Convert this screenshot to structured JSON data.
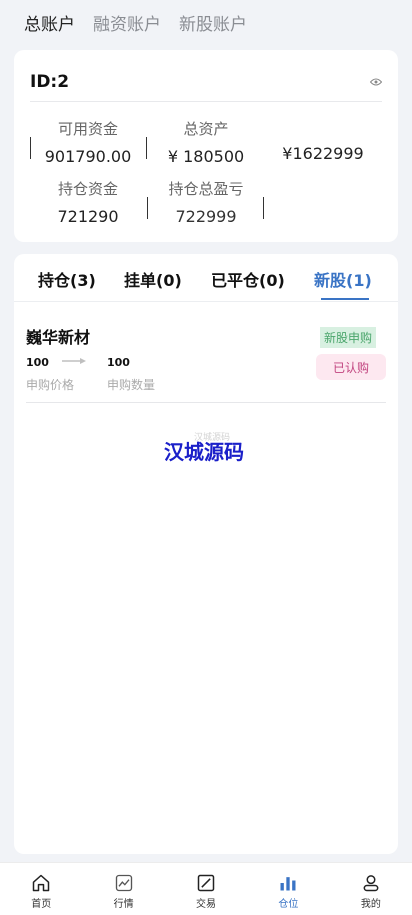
{
  "top_tabs": [
    {
      "label": "总账户"
    },
    {
      "label": "融资账户"
    },
    {
      "label": "新股账户"
    }
  ],
  "account": {
    "id_label": "ID:2",
    "available_funds_label": "可用资金",
    "available_funds_value": "901790.00",
    "total_assets_label": "总资产",
    "total_assets_value": "¥ 180500",
    "third_value": "¥1622999",
    "position_funds_label": "持仓资金",
    "position_funds_value": "721290",
    "position_pnl_label": "持仓总盈亏",
    "position_pnl_value": "722999"
  },
  "position_tabs": [
    {
      "label": "持仓(3)"
    },
    {
      "label": "挂单(0)"
    },
    {
      "label": "已平仓(0)"
    },
    {
      "label": "新股(1)"
    }
  ],
  "ipo_item": {
    "name": "巍华新材",
    "type_badge": "新股申购",
    "status": "已认购",
    "price_value": "100",
    "price_label": "申购价格",
    "qty_value": "100",
    "qty_label": "申购数量"
  },
  "watermark_small": "汉城源码",
  "watermark": "汉城源码",
  "nav": [
    {
      "label": "首页",
      "icon": "home-icon"
    },
    {
      "label": "行情",
      "icon": "chart-icon"
    },
    {
      "label": "交易",
      "icon": "trade-icon"
    },
    {
      "label": "仓位",
      "icon": "bars-icon"
    },
    {
      "label": "我的",
      "icon": "user-icon"
    }
  ],
  "colors": {
    "accent": "#3a74c5",
    "background": "#f1f3f7",
    "watermark": "#1b20c9"
  }
}
